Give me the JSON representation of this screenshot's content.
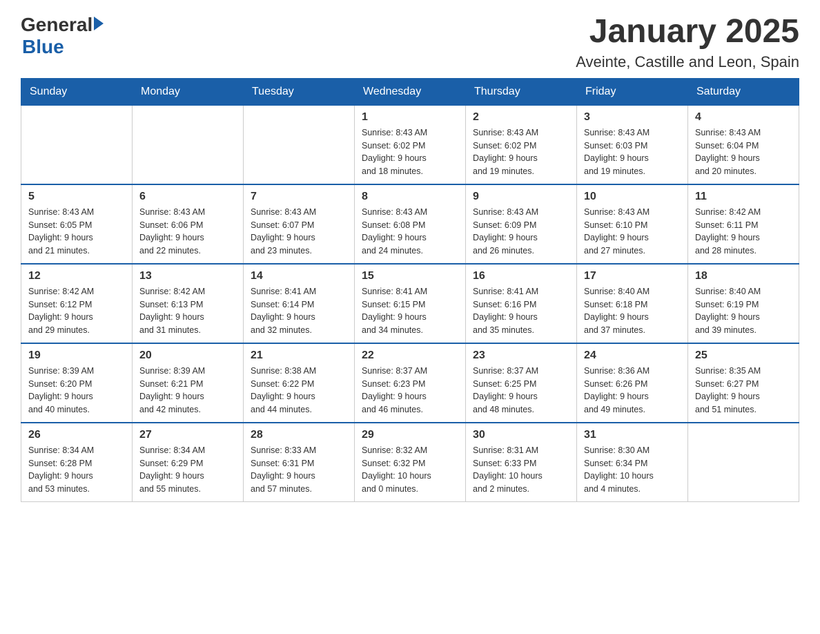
{
  "header": {
    "logo_general": "General",
    "logo_blue": "Blue",
    "title": "January 2025",
    "subtitle": "Aveinte, Castille and Leon, Spain"
  },
  "weekdays": [
    "Sunday",
    "Monday",
    "Tuesday",
    "Wednesday",
    "Thursday",
    "Friday",
    "Saturday"
  ],
  "weeks": [
    [
      {
        "day": "",
        "info": ""
      },
      {
        "day": "",
        "info": ""
      },
      {
        "day": "",
        "info": ""
      },
      {
        "day": "1",
        "info": "Sunrise: 8:43 AM\nSunset: 6:02 PM\nDaylight: 9 hours\nand 18 minutes."
      },
      {
        "day": "2",
        "info": "Sunrise: 8:43 AM\nSunset: 6:02 PM\nDaylight: 9 hours\nand 19 minutes."
      },
      {
        "day": "3",
        "info": "Sunrise: 8:43 AM\nSunset: 6:03 PM\nDaylight: 9 hours\nand 19 minutes."
      },
      {
        "day": "4",
        "info": "Sunrise: 8:43 AM\nSunset: 6:04 PM\nDaylight: 9 hours\nand 20 minutes."
      }
    ],
    [
      {
        "day": "5",
        "info": "Sunrise: 8:43 AM\nSunset: 6:05 PM\nDaylight: 9 hours\nand 21 minutes."
      },
      {
        "day": "6",
        "info": "Sunrise: 8:43 AM\nSunset: 6:06 PM\nDaylight: 9 hours\nand 22 minutes."
      },
      {
        "day": "7",
        "info": "Sunrise: 8:43 AM\nSunset: 6:07 PM\nDaylight: 9 hours\nand 23 minutes."
      },
      {
        "day": "8",
        "info": "Sunrise: 8:43 AM\nSunset: 6:08 PM\nDaylight: 9 hours\nand 24 minutes."
      },
      {
        "day": "9",
        "info": "Sunrise: 8:43 AM\nSunset: 6:09 PM\nDaylight: 9 hours\nand 26 minutes."
      },
      {
        "day": "10",
        "info": "Sunrise: 8:43 AM\nSunset: 6:10 PM\nDaylight: 9 hours\nand 27 minutes."
      },
      {
        "day": "11",
        "info": "Sunrise: 8:42 AM\nSunset: 6:11 PM\nDaylight: 9 hours\nand 28 minutes."
      }
    ],
    [
      {
        "day": "12",
        "info": "Sunrise: 8:42 AM\nSunset: 6:12 PM\nDaylight: 9 hours\nand 29 minutes."
      },
      {
        "day": "13",
        "info": "Sunrise: 8:42 AM\nSunset: 6:13 PM\nDaylight: 9 hours\nand 31 minutes."
      },
      {
        "day": "14",
        "info": "Sunrise: 8:41 AM\nSunset: 6:14 PM\nDaylight: 9 hours\nand 32 minutes."
      },
      {
        "day": "15",
        "info": "Sunrise: 8:41 AM\nSunset: 6:15 PM\nDaylight: 9 hours\nand 34 minutes."
      },
      {
        "day": "16",
        "info": "Sunrise: 8:41 AM\nSunset: 6:16 PM\nDaylight: 9 hours\nand 35 minutes."
      },
      {
        "day": "17",
        "info": "Sunrise: 8:40 AM\nSunset: 6:18 PM\nDaylight: 9 hours\nand 37 minutes."
      },
      {
        "day": "18",
        "info": "Sunrise: 8:40 AM\nSunset: 6:19 PM\nDaylight: 9 hours\nand 39 minutes."
      }
    ],
    [
      {
        "day": "19",
        "info": "Sunrise: 8:39 AM\nSunset: 6:20 PM\nDaylight: 9 hours\nand 40 minutes."
      },
      {
        "day": "20",
        "info": "Sunrise: 8:39 AM\nSunset: 6:21 PM\nDaylight: 9 hours\nand 42 minutes."
      },
      {
        "day": "21",
        "info": "Sunrise: 8:38 AM\nSunset: 6:22 PM\nDaylight: 9 hours\nand 44 minutes."
      },
      {
        "day": "22",
        "info": "Sunrise: 8:37 AM\nSunset: 6:23 PM\nDaylight: 9 hours\nand 46 minutes."
      },
      {
        "day": "23",
        "info": "Sunrise: 8:37 AM\nSunset: 6:25 PM\nDaylight: 9 hours\nand 48 minutes."
      },
      {
        "day": "24",
        "info": "Sunrise: 8:36 AM\nSunset: 6:26 PM\nDaylight: 9 hours\nand 49 minutes."
      },
      {
        "day": "25",
        "info": "Sunrise: 8:35 AM\nSunset: 6:27 PM\nDaylight: 9 hours\nand 51 minutes."
      }
    ],
    [
      {
        "day": "26",
        "info": "Sunrise: 8:34 AM\nSunset: 6:28 PM\nDaylight: 9 hours\nand 53 minutes."
      },
      {
        "day": "27",
        "info": "Sunrise: 8:34 AM\nSunset: 6:29 PM\nDaylight: 9 hours\nand 55 minutes."
      },
      {
        "day": "28",
        "info": "Sunrise: 8:33 AM\nSunset: 6:31 PM\nDaylight: 9 hours\nand 57 minutes."
      },
      {
        "day": "29",
        "info": "Sunrise: 8:32 AM\nSunset: 6:32 PM\nDaylight: 10 hours\nand 0 minutes."
      },
      {
        "day": "30",
        "info": "Sunrise: 8:31 AM\nSunset: 6:33 PM\nDaylight: 10 hours\nand 2 minutes."
      },
      {
        "day": "31",
        "info": "Sunrise: 8:30 AM\nSunset: 6:34 PM\nDaylight: 10 hours\nand 4 minutes."
      },
      {
        "day": "",
        "info": ""
      }
    ]
  ]
}
